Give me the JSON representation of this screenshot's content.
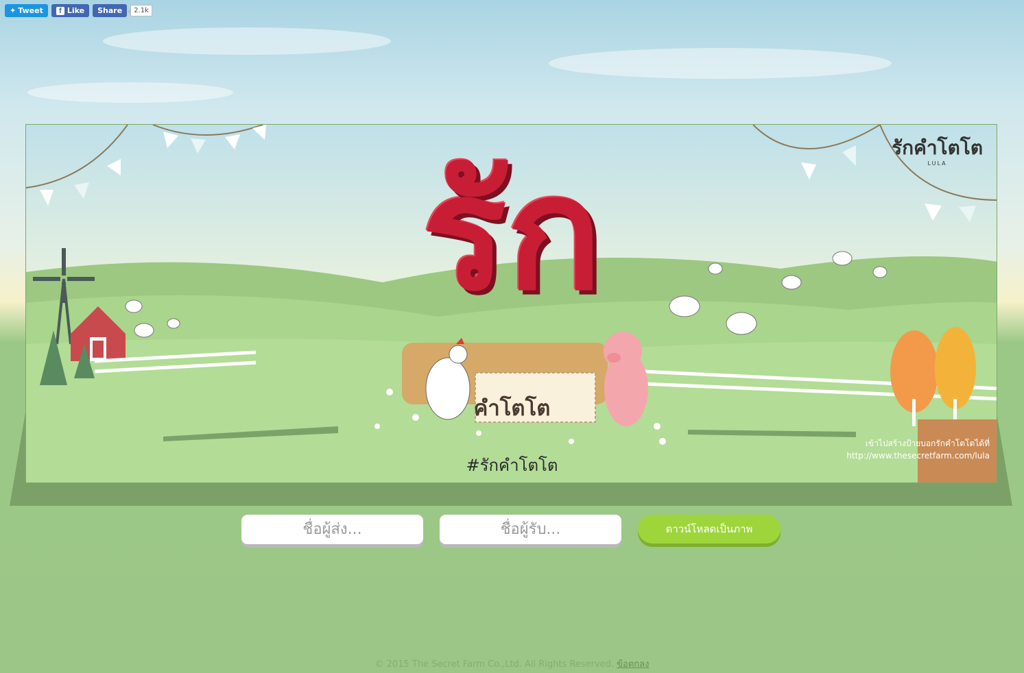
{
  "social": {
    "tweet_label": "Tweet",
    "like_label": "Like",
    "share_label": "Share",
    "share_count": "2.1k"
  },
  "canvas": {
    "big_text": "รัก",
    "sign_text": "คำโตโต",
    "hashtag": "#รักคำโตโต",
    "credit_line1": "เข้าไปสร้างป้ายบอกรักคำโตโตได้ที่",
    "credit_line2": "http://www.thesecretfarm.com/lula",
    "logo_text": "รักคำโตโต",
    "logo_sub": "LULA"
  },
  "form": {
    "sender_placeholder": "ชื่อผู้ส่ง...",
    "receiver_placeholder": "ชื่อผู้รับ...",
    "download_label": "ดาวน์โหลดเป็นภาพ"
  },
  "footer": {
    "copyright": "© 2015 The Secret Farm Co.,Ltd. All Rights Reserved.",
    "terms_link": "ข้อตกลง"
  },
  "colors": {
    "accent_green": "#9ed53b",
    "love_red": "#c81e35",
    "twitter": "#1b95e0",
    "facebook": "#4267b2"
  }
}
